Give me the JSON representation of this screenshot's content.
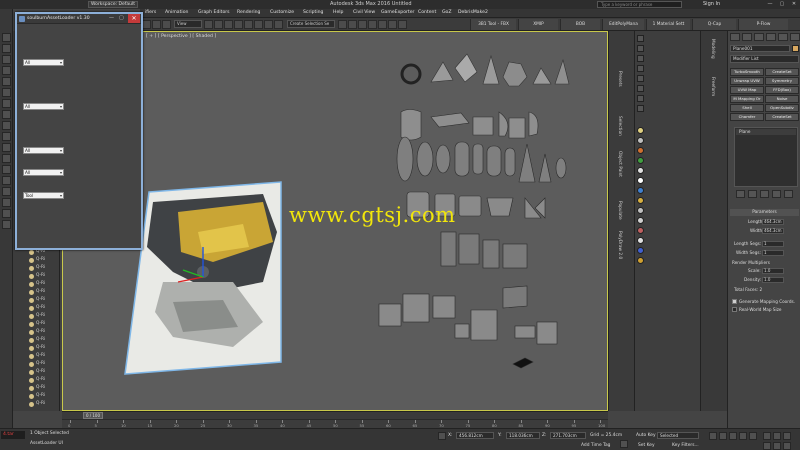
{
  "titlebar": {
    "workspace": "Workspace: Default",
    "title": "Autodesk 3ds Max 2016     Untitled",
    "search_placeholder": "Type a keyword or phrase",
    "signin": "Sign In",
    "buttons": [
      "—",
      "▢",
      "✕"
    ]
  },
  "menubar": {
    "items": [
      "ifiers",
      "Animation",
      "Graph Editors",
      "Rendering",
      "Customize",
      "Scripting",
      "Help",
      "Civil View",
      "GameExporter",
      "Content",
      "GoZ",
      "DebrisMake2"
    ]
  },
  "toolbar": {
    "view_select": "View",
    "selection_set": "Create Selection Se",
    "tabs": [
      "3B1 Tool - FBX",
      "XMIP",
      "BOB",
      "EditPolyMana",
      "1 Material Sett",
      "Q-Cap",
      "P-Flow"
    ]
  },
  "assetpanel": {
    "title": "soulburnAssetLoader v1.30",
    "dropdowns": [
      "All",
      "All",
      "All",
      "All",
      "Tool"
    ]
  },
  "viewport": {
    "label": "[ + ] [ Perspective ] [ Shaded ]",
    "watermark": "www.cgtsj.com"
  },
  "explorer": {
    "rows": [
      "Q-Ri",
      "Q-Ri",
      "Q-Ri",
      "Q-Ri",
      "Q-Ri",
      "Q-Ri",
      "Q-Ri",
      "Q-Ri",
      "Q-Ri",
      "Q-Ri",
      "Q-Ri",
      "Q-Ri",
      "Q-Ri",
      "Q-Ri",
      "Q-Ri",
      "Q-Ri",
      "Q-Ri",
      "Q-Ri",
      "Q-Ri",
      "Q-Ri"
    ]
  },
  "timeline": {
    "slider": "0 / 100",
    "ticks": [
      "0",
      "5",
      "10",
      "15",
      "20",
      "25",
      "30",
      "35",
      "40",
      "45",
      "50",
      "55",
      "60",
      "65",
      "70",
      "75",
      "80",
      "85",
      "90",
      "95",
      "100"
    ]
  },
  "statusbar": {
    "maxscript": "4.tar",
    "selected": "1 Object Selected",
    "prompt": "AssetLoader UI",
    "x_label": "X:",
    "x_value": "456.812cm",
    "y_label": "Y:",
    "y_value": "118.036cm",
    "z_label": "Z:",
    "z_value": "271.703cm",
    "grid": "Grid = 25.4cm",
    "add_time_tag": "Add Time Tag",
    "auto_key": "Auto Key",
    "set_key": "Set Key",
    "selected_dropdown": "Selected",
    "key_filters": "Key Filters..."
  },
  "rightdock": {
    "labels": [
      "Presets",
      "Selection",
      "Object Paint",
      "Populate",
      "PolyDraw 2.0"
    ]
  },
  "cmdstrip": {
    "labels": [
      "Modeling",
      "Freeform"
    ]
  },
  "cmdpanel": {
    "name": "Plane001",
    "modifier_list": "Modifier List",
    "buttons": [
      "TurboSmooth",
      "CreateSet",
      "Unwrap UVW",
      "Symmetry",
      "UVW Map",
      "FFD(Box)",
      "M Mapping Or",
      "Noise",
      "Shell",
      "OpenSubdiv",
      "Chamfer",
      "CreateSet"
    ],
    "stack_item": "Plane",
    "params_header": "Parameters",
    "length_label": "Length:",
    "length_value": "464.3cm",
    "width_label": "Width:",
    "width_value": "464.3cm",
    "length_segs_label": "Length Segs:",
    "length_segs": "1",
    "width_segs_label": "Width Segs:",
    "width_segs": "1",
    "render_mult": "Render Multipliers",
    "scale_label": "Scale:",
    "scale_value": "1.0",
    "density_label": "Density:",
    "density_value": "1.0",
    "total_faces": "Total Faces: 2",
    "gen_coords": "Generate Mapping Coords.",
    "real_world": "Real-World Map Size"
  },
  "colors": {
    "viewport_bg": "#5c5c5c",
    "viewport_border": "#c8c84a",
    "watermark": "#f1e60b",
    "panel_border": "#8db0d9",
    "close_red": "#c43a3a"
  }
}
